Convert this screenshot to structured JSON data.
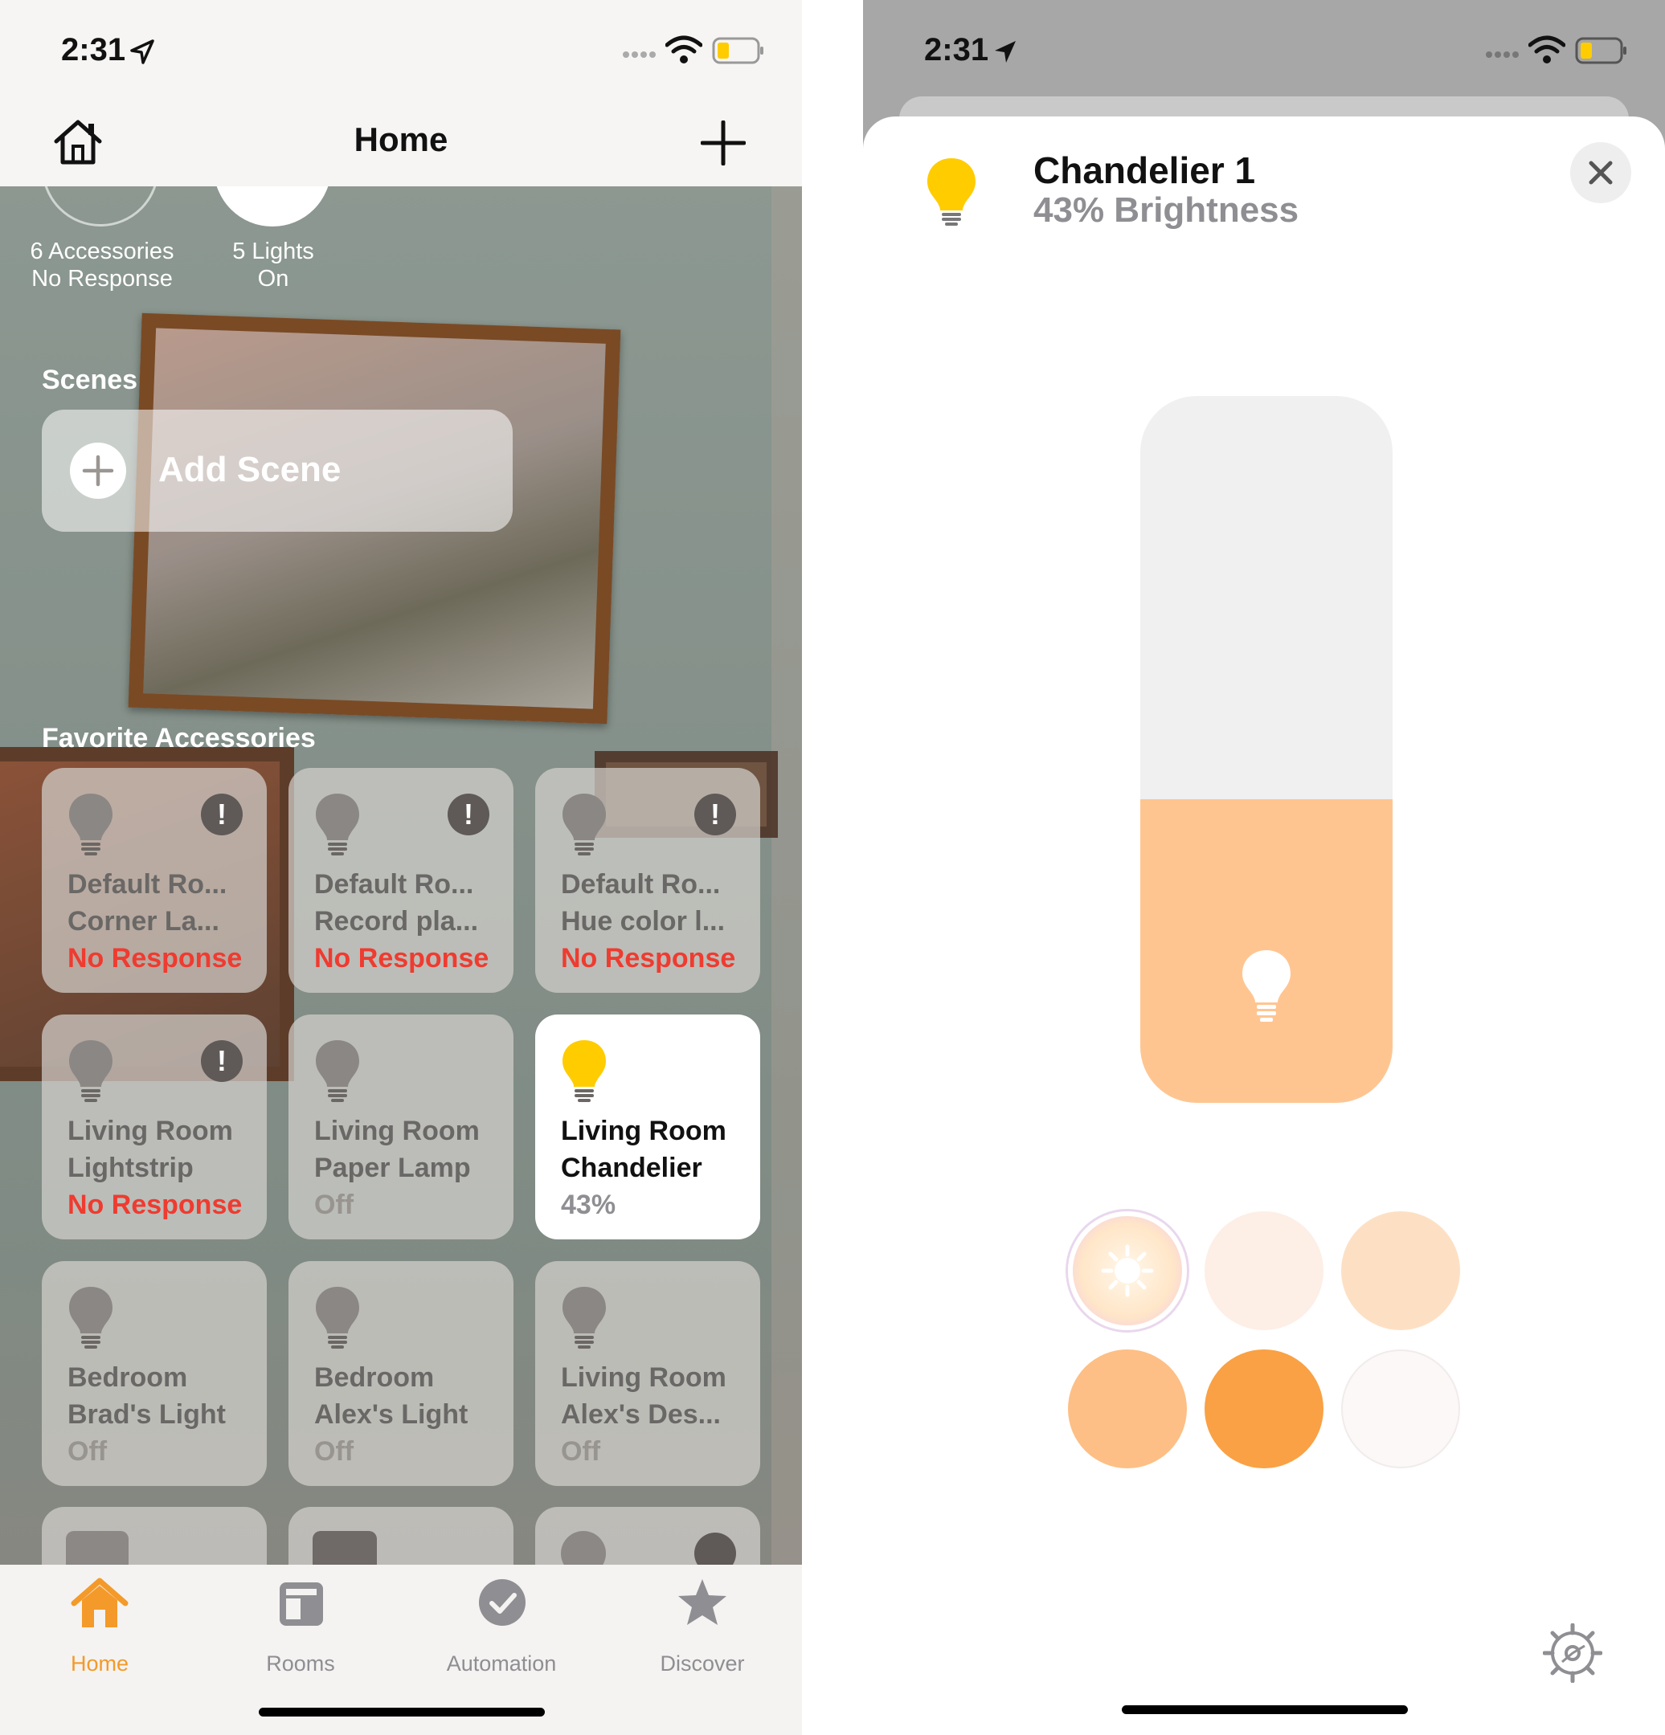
{
  "left_screen": {
    "status": {
      "time": "2:31"
    },
    "header": {
      "title": "Home"
    },
    "summary": [
      {
        "line1": "6 Accessories",
        "line2": "No Response"
      },
      {
        "line1": "5 Lights",
        "line2": "On"
      }
    ],
    "scenes": {
      "title": "Scenes",
      "add_label": "Add Scene"
    },
    "favorites": {
      "title": "Favorite Accessories",
      "tiles": [
        {
          "l1": "Default Ro...",
          "l2": "Corner La...",
          "status": "No Response",
          "alert": "!"
        },
        {
          "l1": "Default Ro...",
          "l2": "Record pla...",
          "status": "No Response",
          "alert": "!"
        },
        {
          "l1": "Default Ro...",
          "l2": "Hue color l...",
          "status": "No Response",
          "alert": "!"
        },
        {
          "l1": "Living Room",
          "l2": "Lightstrip",
          "status": "No Response",
          "alert": "!"
        },
        {
          "l1": "Living Room",
          "l2": "Paper Lamp",
          "status": "Off"
        },
        {
          "l1": "Living Room",
          "l2": "Chandelier",
          "status": "43%"
        },
        {
          "l1": "Bedroom",
          "l2": "Brad's Light",
          "status": "Off"
        },
        {
          "l1": "Bedroom",
          "l2": "Alex's Light",
          "status": "Off"
        },
        {
          "l1": "Living Room",
          "l2": "Alex's Des...",
          "status": "Off"
        }
      ]
    },
    "tabs": [
      {
        "label": "Home",
        "icon": "house-icon"
      },
      {
        "label": "Rooms",
        "icon": "rooms-icon"
      },
      {
        "label": "Automation",
        "icon": "automation-clock-icon"
      },
      {
        "label": "Discover",
        "icon": "star-icon"
      }
    ],
    "colors": {
      "accent": "#f39a2a",
      "error": "#ef3b30",
      "bulb_on": "#ffcc00"
    }
  },
  "right_screen": {
    "status": {
      "time": "2:31"
    },
    "accessory": {
      "name": "Chandelier 1",
      "subtitle": "43% Brightness"
    },
    "brightness": 0.43,
    "swatches": [
      "#ffd9a8",
      "#fdeee6",
      "#fde0c4",
      "#fdbf85",
      "#f9a144",
      "#fcf8f7"
    ],
    "slider_fill_color": "#ffc591"
  }
}
